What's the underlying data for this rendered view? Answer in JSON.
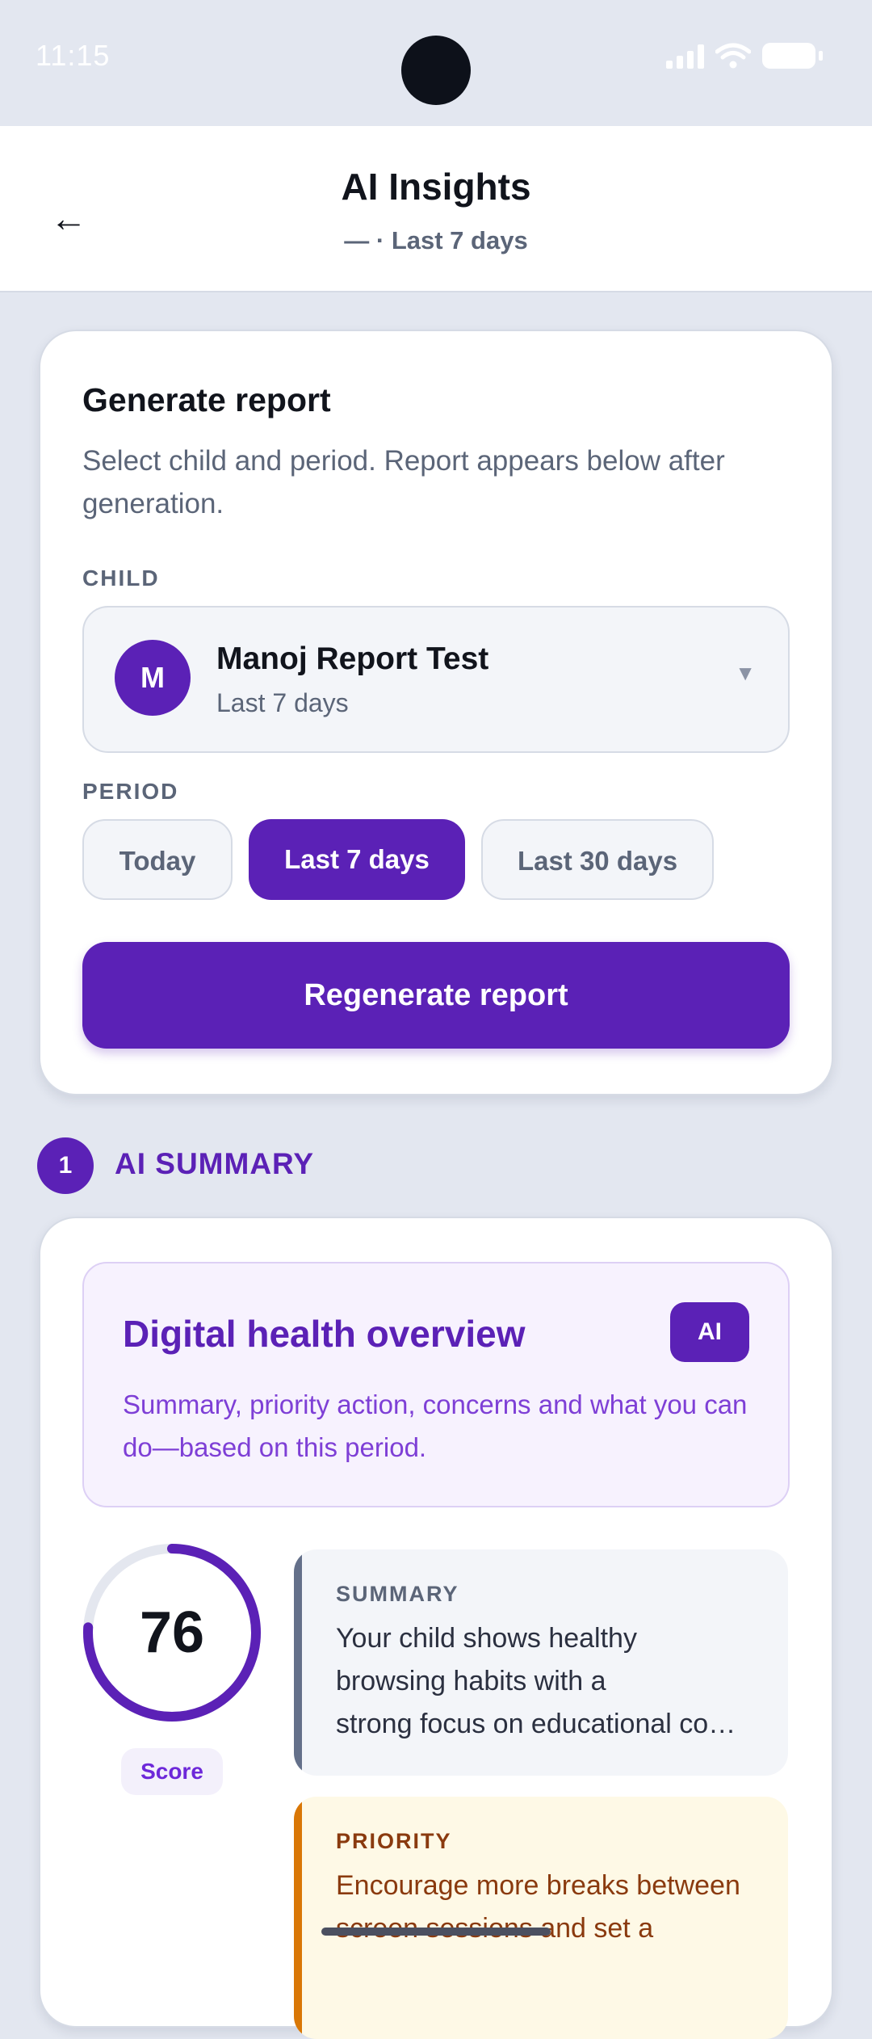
{
  "status_bar": {
    "time": "11:15"
  },
  "header": {
    "back_icon": "←",
    "title": "AI Insights",
    "subtitle": "— · Last 7 days"
  },
  "generate": {
    "title": "Generate report",
    "description": "Select child and period. Report appears below after generation.",
    "child_label": "CHILD",
    "child": {
      "initial": "M",
      "name": "Manoj Report Test",
      "period": "Last 7 days",
      "caret": "▼"
    },
    "period_label": "PERIOD",
    "periods": [
      {
        "label": "Today",
        "selected": false
      },
      {
        "label": "Last 7 days",
        "selected": true
      },
      {
        "label": "Last 30 days",
        "selected": false
      }
    ],
    "button": "Regenerate report"
  },
  "ai_summary": {
    "section_number": "1",
    "section_title": "AI SUMMARY",
    "overview_title": "Digital health overview",
    "overview_badge": "AI",
    "overview_desc": "Summary, priority action, concerns and what you can do—based on this period.",
    "score": {
      "value": "76",
      "max": 100,
      "label": "Score"
    },
    "summary": {
      "caption": "SUMMARY",
      "lines": [
        "Your child shows healthy",
        "browsing habits with a",
        "strong focus on educational co…"
      ]
    },
    "priority": {
      "caption": "PRIORITY",
      "text": "Encourage more breaks between screen sessions and set a"
    }
  },
  "colors": {
    "accent": "#5b21b6",
    "summary_bar": "#64708a",
    "priority_bar": "#d97706"
  }
}
